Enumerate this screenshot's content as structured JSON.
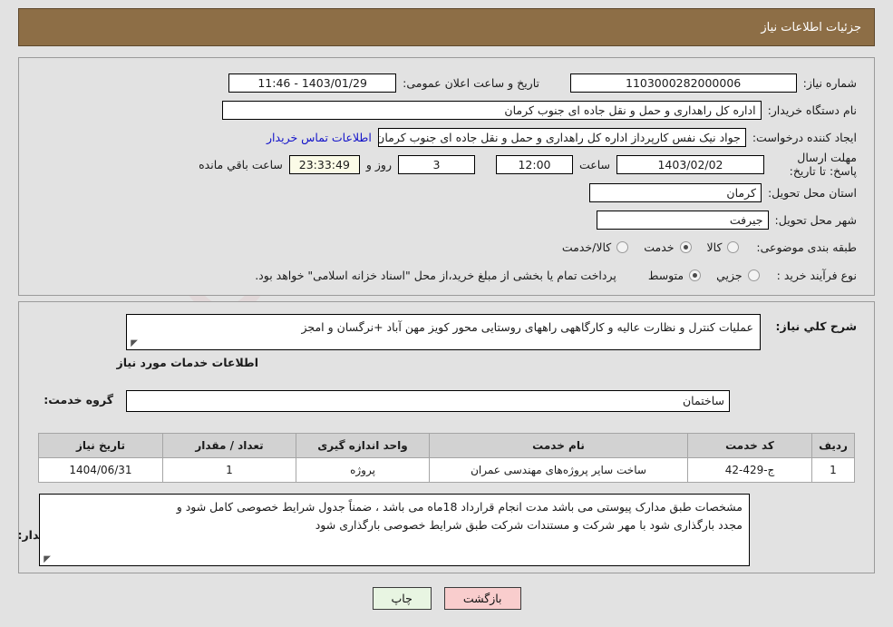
{
  "header": {
    "title": "جزئیات اطلاعات نیاز",
    "bg_color": "#8d6e46"
  },
  "form": {
    "need_number": {
      "label": "شماره نیاز:",
      "value": "1103000282000006"
    },
    "public_announce": {
      "label": "تاریخ و ساعت اعلان عمومی:",
      "value": "1403/01/29 - 11:46"
    },
    "buyer_org": {
      "label": "نام دستگاه خریدار:",
      "value": "اداره کل راهداری و حمل و نقل جاده ای جنوب کرمان"
    },
    "requester": {
      "label": "ایجاد کننده درخواست:",
      "value": "جواد  نیک نفس کارپرداز اداره کل راهداری و حمل و نقل جاده ای جنوب کرمان",
      "contact_link": "اطلاعات تماس خریدار"
    },
    "deadline": {
      "label": "مهلت ارسال پاسخ: تا تاریخ:",
      "date": "1403/02/02",
      "time_label": "ساعت",
      "time": "12:00",
      "days": "3",
      "days_label": "روز و",
      "timer": "23:33:49",
      "timer_label": "ساعت باقي مانده"
    },
    "province": {
      "label": "استان محل تحویل:",
      "value": "کرمان"
    },
    "city": {
      "label": "شهر محل تحویل:",
      "value": "جیرفت"
    },
    "category": {
      "label": "طبقه بندی موضوعی:",
      "options": [
        "کالا",
        "خدمت",
        "کالا/خدمت"
      ],
      "selected": "خدمت"
    },
    "process_type": {
      "label": "نوع فرآیند خرید :",
      "options": [
        "جزیي",
        "متوسط"
      ],
      "selected": "متوسط",
      "note": "پرداخت تمام یا بخشی از مبلغ خرید،از محل \"اسناد خزانه اسلامی\" خواهد بود."
    }
  },
  "general_description": {
    "label": "شرح کلي نیاز:",
    "value": "عملیات کنترل و نظارت عالیه و کارگاههی راههای روستایی محور کویز مهن آباد +نرگسان و امجز"
  },
  "services_section": {
    "heading": "اطلاعات خدمات مورد نیاز",
    "service_group": {
      "label": "گروه خدمت:",
      "value": "ساختمان"
    }
  },
  "table": {
    "columns": [
      "ردیف",
      "کد خدمت",
      "نام خدمت",
      "واحد اندازه گیری",
      "تعداد / مقدار",
      "تاریخ نیاز"
    ],
    "rows": [
      {
        "row_no": "1",
        "service_code": "ج-429-42",
        "service_name": "ساخت سایر پروژه‌های مهندسی عمران",
        "unit": "پروژه",
        "quantity": "1",
        "need_date": "1404/06/31"
      }
    ]
  },
  "buyer_notes": {
    "label": "توضیحات خریدار:",
    "line1": "مشخصات طبق مدارک پیوستی می باشد مدت انجام قرارداد 18ماه می باشد ، ضمناً جدول شرایط خصوصی کامل شود و",
    "line2": "مجدد بارگذاری شود با مهر شرکت و مستندات شرکت طبق شرایط خصوصی بارگذاری شود"
  },
  "buttons": {
    "print": "چاپ",
    "back": "بازگشت"
  },
  "watermark": {
    "text": "AriaTender.net"
  }
}
